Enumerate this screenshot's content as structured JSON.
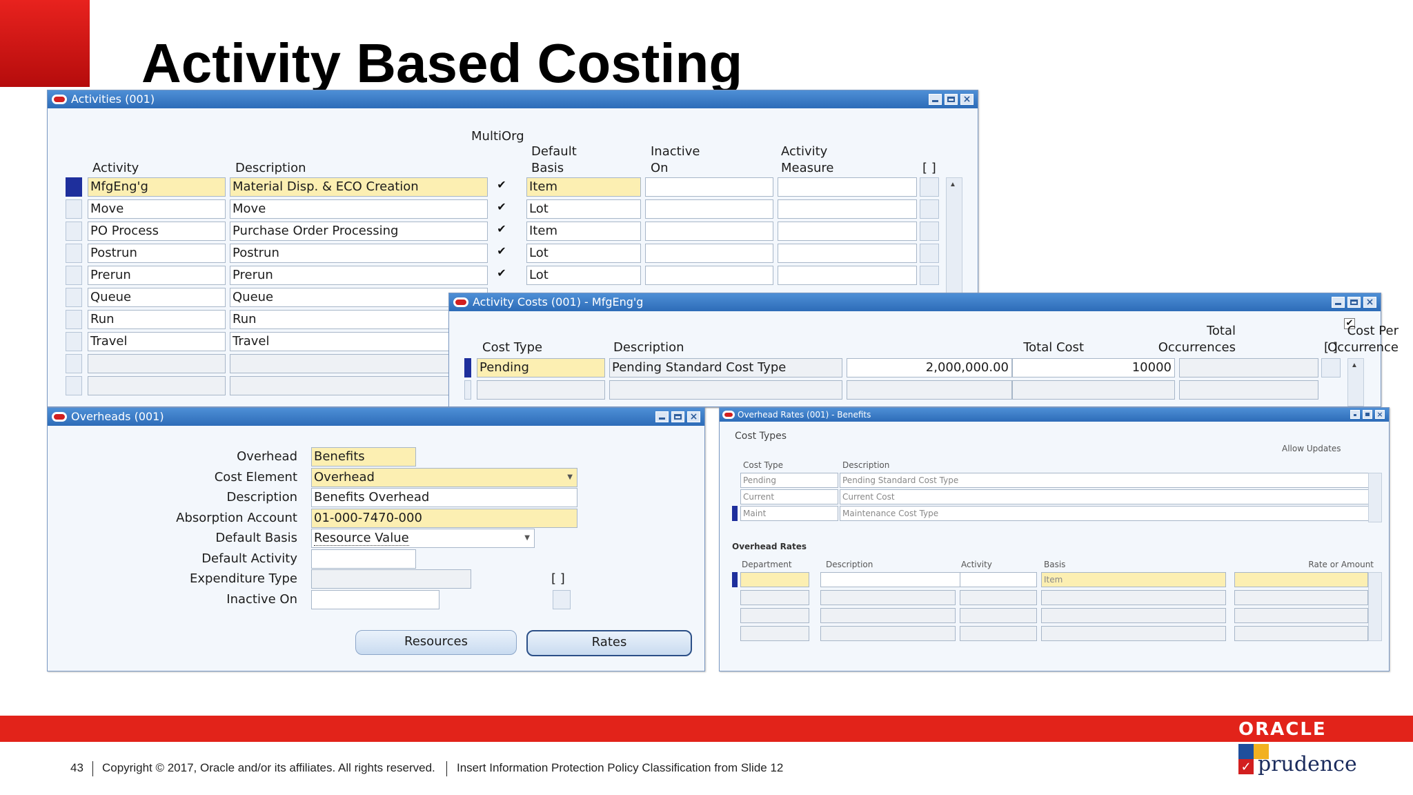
{
  "slide": {
    "title": "Activity Based Costing"
  },
  "activities": {
    "title": "Activities (001)",
    "headers": {
      "activity": "Activity",
      "description": "Description",
      "multiorg": "MultiOrg",
      "default_basis_1": "Default",
      "default_basis_2": "Basis",
      "inactive_1": "Inactive",
      "inactive_2": "On",
      "measure_1": "Activity",
      "measure_2": "Measure",
      "bracket": "[ ]"
    },
    "rows": [
      {
        "activity": "MfgEng'g",
        "description": "Material Disp. & ECO Creation",
        "basis": "Item",
        "checked": "✔"
      },
      {
        "activity": "Move",
        "description": "Move",
        "basis": "Lot",
        "checked": "✔"
      },
      {
        "activity": "PO Process",
        "description": "Purchase Order Processing",
        "basis": "Item",
        "checked": "✔"
      },
      {
        "activity": "Postrun",
        "description": "Postrun",
        "basis": "Lot",
        "checked": "✔"
      },
      {
        "activity": "Prerun",
        "description": "Prerun",
        "basis": "Lot",
        "checked": "✔"
      },
      {
        "activity": "Queue",
        "description": "Queue",
        "basis": "",
        "checked": ""
      },
      {
        "activity": "Run",
        "description": "Run",
        "basis": "",
        "checked": ""
      },
      {
        "activity": "Travel",
        "description": "Travel",
        "basis": "",
        "checked": ""
      }
    ]
  },
  "activity_costs": {
    "title": "Activity Costs (001) - MfgEng'g",
    "headers": {
      "cost_type": "Cost Type",
      "description": "Description",
      "total_cost": "Total Cost",
      "total_occ_1": "Total",
      "total_occ_2": "Occurrences",
      "cost_per_1": "Cost Per",
      "cost_per_2": "Occurrence",
      "bracket": "[ ]",
      "check": "✔"
    },
    "row": {
      "cost_type": "Pending",
      "description": "Pending Standard Cost Type",
      "total_cost": "2,000,000.00",
      "occurrences": "10000"
    }
  },
  "overheads": {
    "title": "Overheads (001)",
    "labels": {
      "overhead": "Overhead",
      "cost_element": "Cost Element",
      "description": "Description",
      "absorption": "Absorption Account",
      "default_basis": "Default Basis",
      "default_activity": "Default Activity",
      "expenditure": "Expenditure Type",
      "inactive": "Inactive On",
      "bracket": "[ ]"
    },
    "values": {
      "overhead": "Benefits",
      "cost_element": "Overhead",
      "description": "Benefits Overhead",
      "absorption": "01-000-7470-000",
      "default_basis": "Resource Value"
    },
    "buttons": {
      "resources": "Resources",
      "rates": "Rates"
    }
  },
  "overhead_rates": {
    "title": "Overhead Rates (001) - Benefits",
    "cost_types_label": "Cost Types",
    "allow_updates": "Allow Updates",
    "headers": {
      "cost_type": "Cost Type",
      "description": "Description",
      "department": "Department",
      "description2": "Description",
      "activity": "Activity",
      "basis": "Basis",
      "rate": "Rate or Amount",
      "bracket": "[ ]"
    },
    "cost_types": [
      {
        "type": "Pending",
        "description": "Pending Standard Cost Type"
      },
      {
        "type": "Current",
        "description": "Current Cost"
      },
      {
        "type": "Maint",
        "description": "Maintenance Cost Type"
      }
    ],
    "overhead_rates_label": "Overhead Rates",
    "rate_row": {
      "basis": "Item"
    }
  },
  "footer": {
    "page": "43",
    "copyright": "Copyright © 2017, Oracle and/or its affiliates. All rights reserved.",
    "policy": "Insert Information Protection Policy Classification from Slide 12",
    "oracle": "ORACLE",
    "prudence": "prudence"
  },
  "colors": {
    "oracle_red": "#e2231a",
    "titlebar_blue": "#2d6cb8",
    "selected_row": "#1e2f9c",
    "required_field": "#fcefb2"
  }
}
